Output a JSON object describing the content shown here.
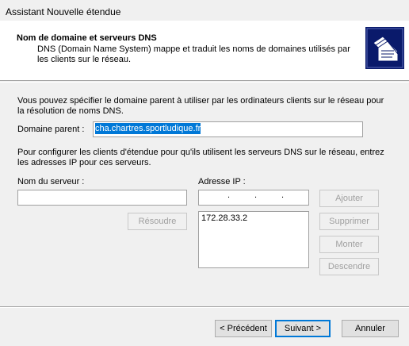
{
  "window": {
    "title": "Assistant Nouvelle étendue"
  },
  "header": {
    "title": "Nom de domaine et serveurs DNS",
    "description": "DNS (Domain Name System) mappe et traduit les noms de domaines utilisés par les clients sur le réseau.",
    "icon": "wizard-documents-icon"
  },
  "main": {
    "intro": "Vous pouvez spécifier le domaine parent à utiliser par les ordinateurs clients sur le réseau pour la résolution de noms DNS.",
    "parent_domain_label": "Domaine parent :",
    "parent_domain_value": "cha.chartres.sportludique.fr",
    "dns_intro": "Pour configurer les clients d'étendue pour qu'ils utilisent les serveurs DNS sur le réseau, entrez les adresses IP pour ces serveurs.",
    "server_name_label": "Nom du serveur :",
    "server_name_value": "",
    "ip_address_label": "Adresse IP :",
    "ip_dots": [
      ".",
      ".",
      "."
    ],
    "ip_list": [
      "172.28.33.2"
    ],
    "buttons": {
      "resolve": "Résoudre",
      "add": "Ajouter",
      "remove": "Supprimer",
      "up": "Monter",
      "down": "Descendre"
    }
  },
  "footer": {
    "back": "< Précédent",
    "next": "Suivant >",
    "cancel": "Annuler"
  }
}
